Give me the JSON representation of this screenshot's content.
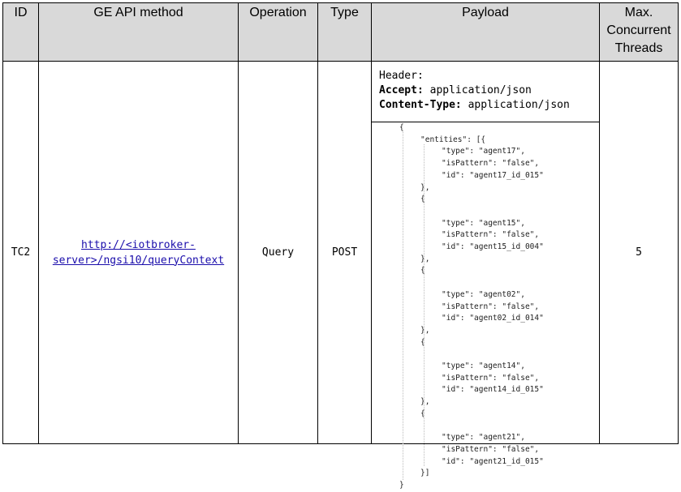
{
  "headers": {
    "id": "ID",
    "method": "GE API method",
    "operation": "Operation",
    "type": "Type",
    "payload": "Payload",
    "threads": "Max. Concurrent Threads"
  },
  "row": {
    "id": "TC2",
    "method_url_line1": "http://<iotbroker-",
    "method_url_line2": "server>/ngsi10/queryContext",
    "operation": "Query",
    "type": "POST",
    "threads": "5",
    "payload_header": {
      "title": "Header:",
      "accept_key": "Accept:",
      "accept_value": "application/json",
      "content_type_key": "Content-Type:",
      "content_type_value": "application/json"
    },
    "payload_body": {
      "open": "{",
      "entities_open": "\"entities\": [{",
      "entities": [
        {
          "type": "\"type\": \"agent17\",",
          "pattern": "\"isPattern\": \"false\",",
          "id": "\"id\": \"agent17_id_015\""
        },
        {
          "type": "\"type\": \"agent15\",",
          "pattern": "\"isPattern\": \"false\",",
          "id": "\"id\": \"agent15_id_004\""
        },
        {
          "type": "\"type\": \"agent02\",",
          "pattern": "\"isPattern\": \"false\",",
          "id": "\"id\": \"agent02_id_014\""
        },
        {
          "type": "\"type\": \"agent14\",",
          "pattern": "\"isPattern\": \"false\",",
          "id": "\"id\": \"agent14_id_015\""
        },
        {
          "type": "\"type\": \"agent21\",",
          "pattern": "\"isPattern\": \"false\",",
          "id": "\"id\": \"agent21_id_015\""
        }
      ],
      "entity_close": "},",
      "entity_open": "{",
      "entities_close": "}]",
      "close": "}"
    }
  }
}
